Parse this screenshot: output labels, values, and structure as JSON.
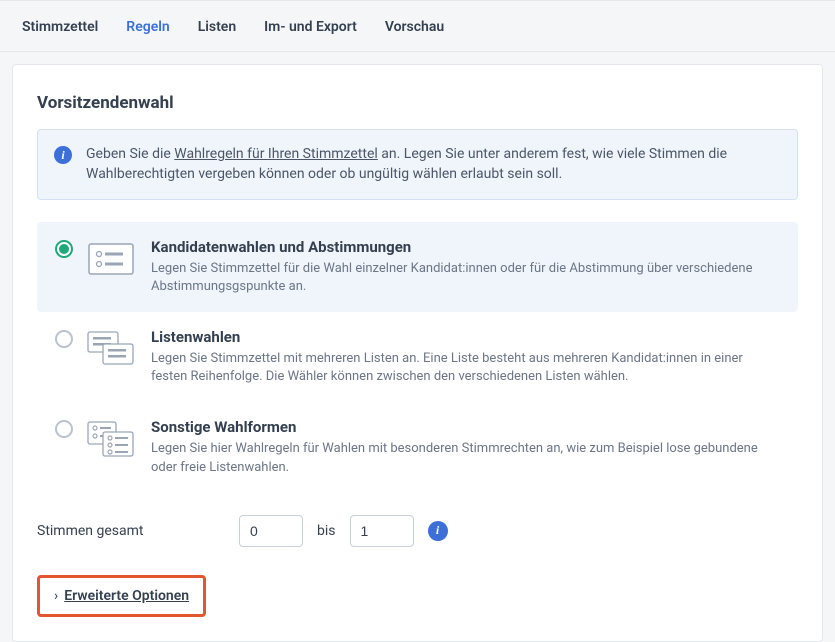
{
  "tabs": {
    "stimmzettel": "Stimmzettel",
    "regeln": "Regeln",
    "listen": "Listen",
    "import_export": "Im- und Export",
    "vorschau": "Vorschau"
  },
  "page_title": "Vorsitzendenwahl",
  "infobox": {
    "pre": "Geben Sie die ",
    "link": "Wahlregeln für Ihren Stimmzettel",
    "post": " an. Legen Sie unter anderem fest, wie viele Stimmen die Wahlberechtigten vergeben können oder ob ungültig wählen erlaubt sein soll."
  },
  "options": {
    "kandidaten": {
      "title": "Kandidatenwahlen und Abstimmungen",
      "desc": "Legen Sie Stimmzettel für die Wahl einzelner Kandidat:innen oder für die Abstimmung über verschiedene Abstimmungsgspunkte an."
    },
    "listen": {
      "title": "Listenwahlen",
      "desc": "Legen Sie Stimmzettel mit mehreren Listen an. Eine Liste besteht aus mehreren Kandidat:innen in einer festen Reihenfolge. Die Wähler können zwischen den verschiedenen Listen wählen."
    },
    "sonstige": {
      "title": "Sonstige Wahlformen",
      "desc": "Legen Sie hier Wahlregeln für Wahlen mit besonderen Stimmrechten an, wie zum Beispiel lose gebundene oder freie Listenwahlen."
    }
  },
  "votes": {
    "label": "Stimmen gesamt",
    "from": "0",
    "to_label": "bis",
    "to": "1"
  },
  "expand": "Erweiterte Optionen"
}
